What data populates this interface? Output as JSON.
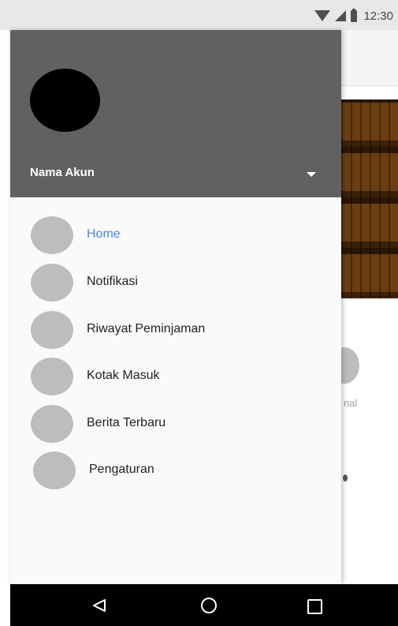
{
  "status_bar": {
    "time": "12:30",
    "icons": [
      "wifi-icon",
      "signal-icon",
      "battery-icon"
    ]
  },
  "background_app": {
    "partial_label": "nal"
  },
  "drawer": {
    "header": {
      "account_name": "Nama Akun",
      "header_color": "#616161",
      "avatar_color": "#000000"
    },
    "items": [
      {
        "label": "Home",
        "active": true
      },
      {
        "label": "Notifikasi",
        "active": false
      },
      {
        "label": "Riwayat Peminjaman",
        "active": false
      },
      {
        "label": "Kotak Masuk",
        "active": false
      },
      {
        "label": "Berita Terbaru",
        "active": false
      },
      {
        "label": "Pengaturan",
        "active": false
      }
    ],
    "active_color": "#4a84e8"
  },
  "nav_bar": {
    "buttons": [
      "back-icon",
      "home-icon",
      "recents-icon"
    ]
  }
}
